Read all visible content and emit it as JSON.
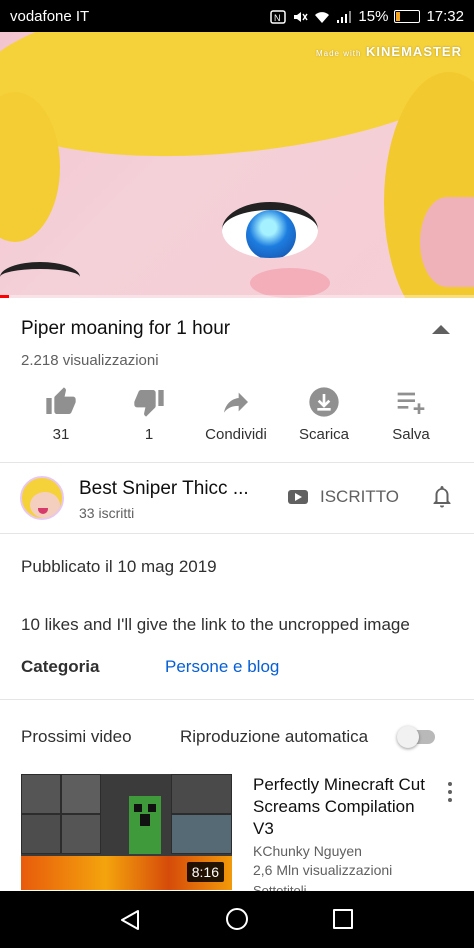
{
  "status_bar": {
    "carrier": "vodafone IT",
    "battery": "15%",
    "time": "17:32"
  },
  "video": {
    "watermark_prefix": "Made with",
    "watermark_brand": "KINEMASTER",
    "progress_fraction": 0.02
  },
  "info": {
    "title": "Piper moaning for 1 hour",
    "views": "2.218 visualizzazioni"
  },
  "actions": {
    "like_count": "31",
    "dislike_count": "1",
    "share": "Condividi",
    "download": "Scarica",
    "save": "Salva"
  },
  "channel": {
    "name": "Best Sniper Thicc ...",
    "subscribers": "33 iscritti",
    "subscribe_state": "ISCRITTO"
  },
  "description": {
    "published": "Pubblicato il 10 mag 2019",
    "text": "10 likes and I'll give the link to the uncropped image",
    "category_label": "Categoria",
    "category_value": "Persone e blog"
  },
  "up_next": {
    "label": "Prossimi video",
    "autoplay_label": "Riproduzione automatica",
    "autoplay_on": false,
    "video": {
      "title": "Perfectly Minecraft Cut Screams Compilation V3",
      "channel": "KChunky Nguyen",
      "views": "2,6 Mln visualizzazioni",
      "captions": "Sottotitoli",
      "duration": "8:16"
    }
  },
  "colors": {
    "link": "#065fd4",
    "progress": "#ff0000",
    "secondary_text": "#606060",
    "battery": "#f5a623"
  }
}
